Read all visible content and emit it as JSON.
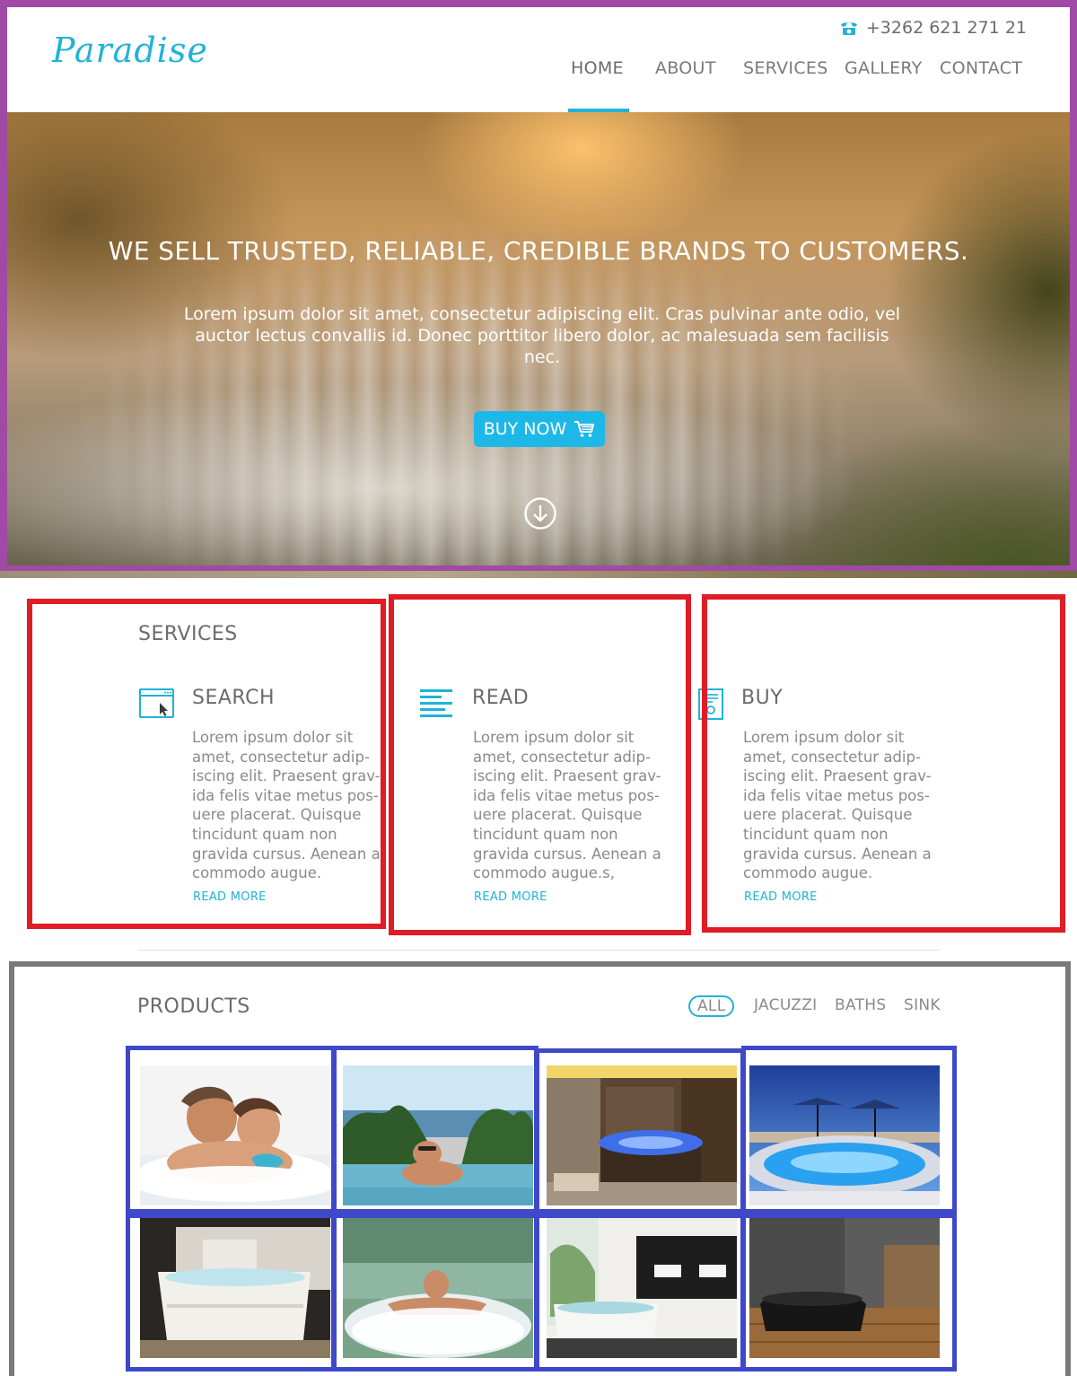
{
  "header": {
    "logo": "Paradise",
    "phone": "+3262 621 271 21",
    "nav": [
      {
        "label": "HOME",
        "active": true
      },
      {
        "label": "ABOUT",
        "active": false
      },
      {
        "label": "SERVICES",
        "active": false
      },
      {
        "label": "GALLERY",
        "active": false
      },
      {
        "label": "CONTACT",
        "active": false
      }
    ]
  },
  "hero": {
    "title": "WE SELL TRUSTED, RELIABLE, CREDIBLE BRANDS TO CUSTOMERS.",
    "text": "Lorem ipsum dolor sit amet, consectetur adipiscing elit. Cras pulvinar ante odio, vel auctor lectus convallis id. Donec porttitor libero dolor, ac malesuada sem facilisis nec.",
    "button_label": "BUY NOW",
    "button_icon": "cart-icon",
    "scroll_icon": "arrow-down-circle-icon"
  },
  "services": {
    "title": "SERVICES",
    "items": [
      {
        "icon": "browser-cursor-icon",
        "heading": "SEARCH",
        "text": "Lorem ipsum dolor sit amet, consectetur adip-iscing elit. Praesent grav-ida felis vitae metus pos-uere placerat. Quisque tincidunt quam non gravida cursus. Aenean a commodo augue.",
        "link": "READ MORE"
      },
      {
        "icon": "text-lines-icon",
        "heading": "READ",
        "text": "Lorem ipsum dolor sit amet, consectetur adip-iscing elit. Praesent grav-ida felis vitae metus pos-uere placerat. Quisque tincidunt quam non gravida cursus. Aenean a commodo augue.s,",
        "link": "READ MORE"
      },
      {
        "icon": "certificate-icon",
        "heading": "BUY",
        "text": "Lorem ipsum dolor sit amet, consectetur adip-iscing elit. Praesent grav-ida felis vitae metus pos-uere placerat. Quisque tincidunt quam non gravida cursus. Aenean a commodo augue.",
        "link": "READ MORE"
      }
    ]
  },
  "products": {
    "title": "PRODUCTS",
    "filters": [
      {
        "label": "ALL",
        "active": true
      },
      {
        "label": "JACUZZI",
        "active": false
      },
      {
        "label": "BATHS",
        "active": false
      },
      {
        "label": "SINK",
        "active": false
      }
    ],
    "thumbnails": [
      "couple-jacuzzi-photo",
      "man-pool-sea-photo",
      "indoor-jacuzzi-room-photo",
      "rooftop-pool-umbrellas-photo",
      "white-bathtub-photo",
      "man-jacuzzi-photo",
      "bathroom-tub-photo",
      "black-freestanding-tub-photo"
    ]
  },
  "colors": {
    "accent": "#1fb3d9",
    "button": "#1db8e8",
    "text": "#6b6b6b",
    "overlay_purple": "#a04aa6",
    "overlay_red": "#e01c24",
    "overlay_gray": "#7a7a7a",
    "overlay_blue": "#3f48c8"
  }
}
